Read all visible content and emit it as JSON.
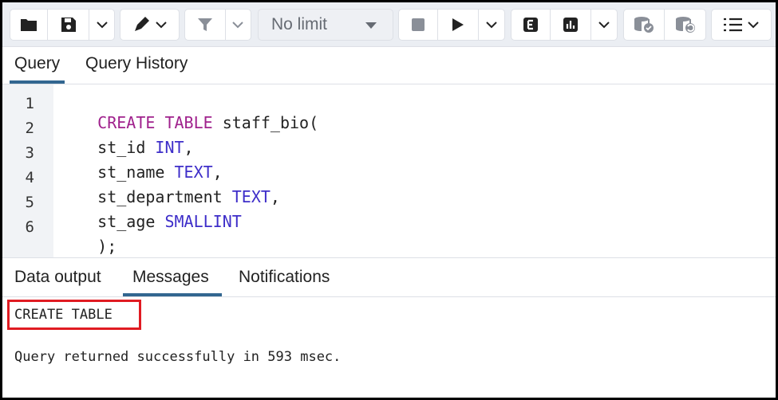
{
  "toolbar": {
    "limit_label": "No limit",
    "icons": [
      "folder-icon",
      "save-icon",
      "chevron-down-icon",
      "pen-icon",
      "filter-icon",
      "stop-icon",
      "play-icon",
      "explain-icon",
      "analyze-icon",
      "commit-icon",
      "rollback-icon",
      "macros-icon"
    ]
  },
  "query_tabs": [
    {
      "label": "Query",
      "active": true
    },
    {
      "label": "Query History",
      "active": false
    }
  ],
  "editor": {
    "lines": [
      {
        "n": "1",
        "tokens": [
          {
            "t": "CREATE TABLE",
            "c": "kw1"
          },
          {
            "t": " staff_bio(",
            "c": ""
          }
        ]
      },
      {
        "n": "2",
        "tokens": [
          {
            "t": "st_id ",
            "c": ""
          },
          {
            "t": "INT",
            "c": "kw2"
          },
          {
            "t": ",",
            "c": ""
          }
        ]
      },
      {
        "n": "3",
        "tokens": [
          {
            "t": "st_name ",
            "c": ""
          },
          {
            "t": "TEXT",
            "c": "kw2"
          },
          {
            "t": ",",
            "c": ""
          }
        ]
      },
      {
        "n": "4",
        "tokens": [
          {
            "t": "st_department ",
            "c": ""
          },
          {
            "t": "TEXT",
            "c": "kw2"
          },
          {
            "t": ",",
            "c": ""
          }
        ]
      },
      {
        "n": "5",
        "tokens": [
          {
            "t": "st_age ",
            "c": ""
          },
          {
            "t": "SMALLINT",
            "c": "kw2"
          }
        ]
      },
      {
        "n": "6",
        "tokens": [
          {
            "t": ");",
            "c": ""
          }
        ]
      }
    ]
  },
  "output_tabs": [
    {
      "label": "Data output",
      "active": false
    },
    {
      "label": "Messages",
      "active": true
    },
    {
      "label": "Notifications",
      "active": false
    }
  ],
  "messages": {
    "line1": "CREATE TABLE",
    "line2": "Query returned successfully in 593 msec."
  },
  "colors": {
    "accent": "#326690",
    "keyword_create": "#a0228d",
    "keyword_type": "#3e2ec9",
    "highlight_box": "#e01b22"
  }
}
